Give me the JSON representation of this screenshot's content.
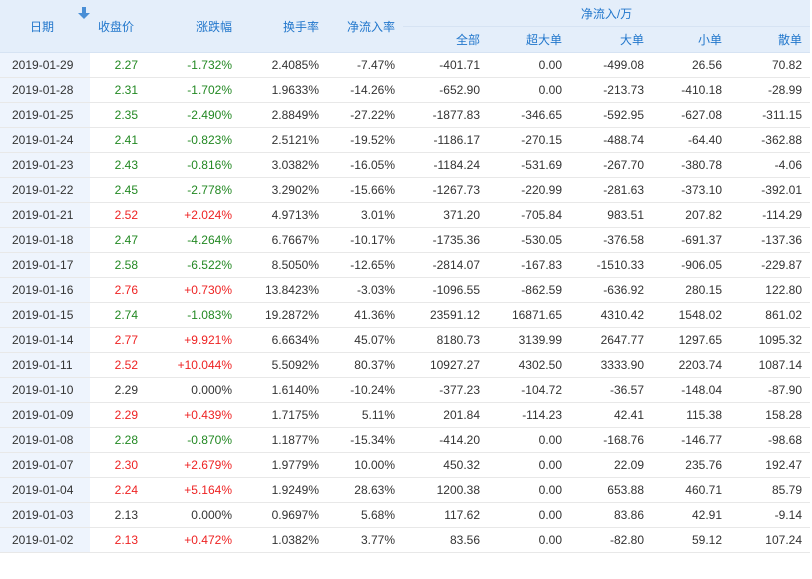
{
  "headers": {
    "date": "日期",
    "close": "收盘价",
    "change": "涨跌幅",
    "turnover": "换手率",
    "netflow_rate": "净流入率",
    "netflow_group": "净流入/万",
    "all": "全部",
    "super": "超大单",
    "large": "大单",
    "small": "小单",
    "retail": "散单"
  },
  "colors": {
    "up": "#ee2222",
    "down": "#228822",
    "flat": "#333333",
    "header_text": "#2277cc",
    "header_bg": "#e4eefa",
    "date_bg": "#eef4fd"
  },
  "icons": {
    "sort": "sort-down-arrow-icon"
  },
  "rows": [
    {
      "date": "2019-01-29",
      "close": "2.27",
      "change": "-1.732%",
      "turnover": "2.4085%",
      "netflow_rate": "-7.47%",
      "all": "-401.71",
      "super": "0.00",
      "large": "-499.08",
      "small": "26.56",
      "retail": "70.82",
      "dir": "down"
    },
    {
      "date": "2019-01-28",
      "close": "2.31",
      "change": "-1.702%",
      "turnover": "1.9633%",
      "netflow_rate": "-14.26%",
      "all": "-652.90",
      "super": "0.00",
      "large": "-213.73",
      "small": "-410.18",
      "retail": "-28.99",
      "dir": "down"
    },
    {
      "date": "2019-01-25",
      "close": "2.35",
      "change": "-2.490%",
      "turnover": "2.8849%",
      "netflow_rate": "-27.22%",
      "all": "-1877.83",
      "super": "-346.65",
      "large": "-592.95",
      "small": "-627.08",
      "retail": "-311.15",
      "dir": "down"
    },
    {
      "date": "2019-01-24",
      "close": "2.41",
      "change": "-0.823%",
      "turnover": "2.5121%",
      "netflow_rate": "-19.52%",
      "all": "-1186.17",
      "super": "-270.15",
      "large": "-488.74",
      "small": "-64.40",
      "retail": "-362.88",
      "dir": "down"
    },
    {
      "date": "2019-01-23",
      "close": "2.43",
      "change": "-0.816%",
      "turnover": "3.0382%",
      "netflow_rate": "-16.05%",
      "all": "-1184.24",
      "super": "-531.69",
      "large": "-267.70",
      "small": "-380.78",
      "retail": "-4.06",
      "dir": "down"
    },
    {
      "date": "2019-01-22",
      "close": "2.45",
      "change": "-2.778%",
      "turnover": "3.2902%",
      "netflow_rate": "-15.66%",
      "all": "-1267.73",
      "super": "-220.99",
      "large": "-281.63",
      "small": "-373.10",
      "retail": "-392.01",
      "dir": "down"
    },
    {
      "date": "2019-01-21",
      "close": "2.52",
      "change": "+2.024%",
      "turnover": "4.9713%",
      "netflow_rate": "3.01%",
      "all": "371.20",
      "super": "-705.84",
      "large": "983.51",
      "small": "207.82",
      "retail": "-114.29",
      "dir": "up"
    },
    {
      "date": "2019-01-18",
      "close": "2.47",
      "change": "-4.264%",
      "turnover": "6.7667%",
      "netflow_rate": "-10.17%",
      "all": "-1735.36",
      "super": "-530.05",
      "large": "-376.58",
      "small": "-691.37",
      "retail": "-137.36",
      "dir": "down"
    },
    {
      "date": "2019-01-17",
      "close": "2.58",
      "change": "-6.522%",
      "turnover": "8.5050%",
      "netflow_rate": "-12.65%",
      "all": "-2814.07",
      "super": "-167.83",
      "large": "-1510.33",
      "small": "-906.05",
      "retail": "-229.87",
      "dir": "down"
    },
    {
      "date": "2019-01-16",
      "close": "2.76",
      "change": "+0.730%",
      "turnover": "13.8423%",
      "netflow_rate": "-3.03%",
      "all": "-1096.55",
      "super": "-862.59",
      "large": "-636.92",
      "small": "280.15",
      "retail": "122.80",
      "dir": "up"
    },
    {
      "date": "2019-01-15",
      "close": "2.74",
      "change": "-1.083%",
      "turnover": "19.2872%",
      "netflow_rate": "41.36%",
      "all": "23591.12",
      "super": "16871.65",
      "large": "4310.42",
      "small": "1548.02",
      "retail": "861.02",
      "dir": "down"
    },
    {
      "date": "2019-01-14",
      "close": "2.77",
      "change": "+9.921%",
      "turnover": "6.6634%",
      "netflow_rate": "45.07%",
      "all": "8180.73",
      "super": "3139.99",
      "large": "2647.77",
      "small": "1297.65",
      "retail": "1095.32",
      "dir": "up"
    },
    {
      "date": "2019-01-11",
      "close": "2.52",
      "change": "+10.044%",
      "turnover": "5.5092%",
      "netflow_rate": "80.37%",
      "all": "10927.27",
      "super": "4302.50",
      "large": "3333.90",
      "small": "2203.74",
      "retail": "1087.14",
      "dir": "up"
    },
    {
      "date": "2019-01-10",
      "close": "2.29",
      "change": "0.000%",
      "turnover": "1.6140%",
      "netflow_rate": "-10.24%",
      "all": "-377.23",
      "super": "-104.72",
      "large": "-36.57",
      "small": "-148.04",
      "retail": "-87.90",
      "dir": "flat"
    },
    {
      "date": "2019-01-09",
      "close": "2.29",
      "change": "+0.439%",
      "turnover": "1.7175%",
      "netflow_rate": "5.11%",
      "all": "201.84",
      "super": "-114.23",
      "large": "42.41",
      "small": "115.38",
      "retail": "158.28",
      "dir": "up"
    },
    {
      "date": "2019-01-08",
      "close": "2.28",
      "change": "-0.870%",
      "turnover": "1.1877%",
      "netflow_rate": "-15.34%",
      "all": "-414.20",
      "super": "0.00",
      "large": "-168.76",
      "small": "-146.77",
      "retail": "-98.68",
      "dir": "down"
    },
    {
      "date": "2019-01-07",
      "close": "2.30",
      "change": "+2.679%",
      "turnover": "1.9779%",
      "netflow_rate": "10.00%",
      "all": "450.32",
      "super": "0.00",
      "large": "22.09",
      "small": "235.76",
      "retail": "192.47",
      "dir": "up"
    },
    {
      "date": "2019-01-04",
      "close": "2.24",
      "change": "+5.164%",
      "turnover": "1.9249%",
      "netflow_rate": "28.63%",
      "all": "1200.38",
      "super": "0.00",
      "large": "653.88",
      "small": "460.71",
      "retail": "85.79",
      "dir": "up"
    },
    {
      "date": "2019-01-03",
      "close": "2.13",
      "change": "0.000%",
      "turnover": "0.9697%",
      "netflow_rate": "5.68%",
      "all": "117.62",
      "super": "0.00",
      "large": "83.86",
      "small": "42.91",
      "retail": "-9.14",
      "dir": "flat"
    },
    {
      "date": "2019-01-02",
      "close": "2.13",
      "change": "+0.472%",
      "turnover": "1.0382%",
      "netflow_rate": "3.77%",
      "all": "83.56",
      "super": "0.00",
      "large": "-82.80",
      "small": "59.12",
      "retail": "107.24",
      "dir": "up"
    }
  ]
}
